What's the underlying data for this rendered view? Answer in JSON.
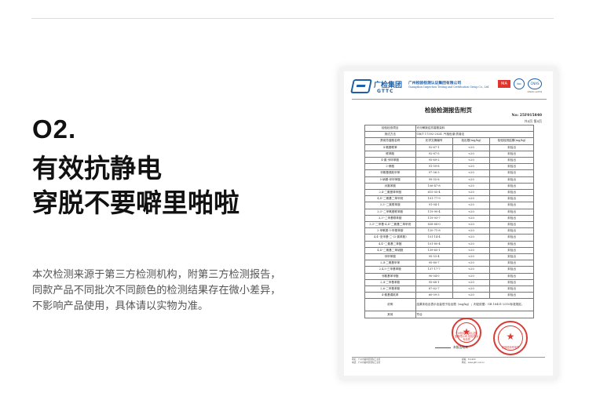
{
  "section": {
    "number": "O2.",
    "headline": [
      "有效抗静电",
      "穿脱不要噼里啪啦"
    ],
    "description": [
      "本次检测来源于第三方检测机构，附第三方检测报告，",
      "同款产品不同批次不同颜色的检测结果存在微小差异，",
      "不影响产品使用，具体请以实物为准。"
    ]
  },
  "report": {
    "brand_cn": "广检集团",
    "brand_en": "GTTC",
    "company_cn": "广州检验检测认证集团有限公司",
    "company_en": "Guangzhou Inspection Testing and Certification Group Co., Ltd.",
    "cert_labels": [
      "MA",
      "ilac",
      "CNAS"
    ],
    "cert_code": "CNAS L1234",
    "title": "检验检测报告附页",
    "report_no": "No: 25F015840",
    "page": "共4页  第4页",
    "item_label": "检验检测项目",
    "item_value": "可分解致癌芳香胺染料",
    "method_label": "测试方法",
    "method_value": "GB/T 17592-2024 ,气相色谱-质谱法",
    "columns": [
      "禁用芳香胺名称",
      "化学文摘编号",
      "检出限(mg/kg)",
      "检验检测结果(mg/kg)"
    ],
    "rows": [
      [
        "4-氨基联苯",
        "92-67-1",
        "<20",
        "未检出"
      ],
      [
        "联苯胺",
        "92-87-5",
        "<20",
        "未检出"
      ],
      [
        "4-氯-邻甲苯胺",
        "95-69-2",
        "<20",
        "未检出"
      ],
      [
        "2-萘胺",
        "91-59-8",
        "<20",
        "未检出"
      ],
      [
        "邻氨基偶氮甲苯",
        "97-56-3",
        "<20",
        "未检出"
      ],
      [
        "5-硝基-邻甲苯胺",
        "99-55-8",
        "<20",
        "未检出"
      ],
      [
        "对氯苯胺",
        "106-47-8",
        "<20",
        "未检出"
      ],
      [
        "2,4-二氨基苯甲醚",
        "615-05-4",
        "<20",
        "未检出"
      ],
      [
        "4,4'-二氨基二苯甲烷",
        "101-77-9",
        "<20",
        "未检出"
      ],
      [
        "3,3'-二氯联苯胺",
        "91-94-1",
        "<20",
        "未检出"
      ],
      [
        "3,3'-二甲氧基联苯胺",
        "119-90-4",
        "<20",
        "未检出"
      ],
      [
        "3,3'-二甲基联苯胺",
        "119-93-7",
        "<20",
        "未检出"
      ],
      [
        "3,3'-二甲基-4,4'-二氨基二苯甲烷",
        "838-88-0",
        "<20",
        "未检出"
      ],
      [
        "2-甲氧基-5-甲基苯胺",
        "120-71-8",
        "<20",
        "未检出"
      ],
      [
        "4,4'-亚甲基-二-(2-氯苯胺)",
        "101-14-4",
        "<20",
        "未检出"
      ],
      [
        "4,4'-二氨基二苯醚",
        "101-80-4",
        "<20",
        "未检出"
      ],
      [
        "4,4'-二氨基二苯硫醚",
        "139-65-1",
        "<20",
        "未检出"
      ],
      [
        "邻甲苯胺",
        "95-53-4",
        "<20",
        "未检出"
      ],
      [
        "2,4-二氨基甲苯",
        "95-80-7",
        "<20",
        "未检出"
      ],
      [
        "2,4,5-三甲基苯胺",
        "137-17-7",
        "<20",
        "未检出"
      ],
      [
        "邻氨基苯甲醚",
        "90-04-0",
        "<20",
        "未检出"
      ],
      [
        "2,4-二甲基苯胺",
        "95-68-1",
        "<20",
        "未检出"
      ],
      [
        "2,6-二甲基苯胺",
        "87-62-7",
        "<20",
        "未检出"
      ],
      [
        "4-氨基偶氮苯",
        "60-09-3",
        "<20",
        "未检出"
      ]
    ],
    "note_label": "说明",
    "note_text": "结果未检出表示含量低于检出限（mg/kg）；判定依据：GB 18401-2010标准规定。",
    "other_label": "其他",
    "other_value": "符合",
    "stamp_1_text": "广州检验检测认证集团有限公司 检验检测专用章",
    "stamp_2_text": "检验检测专用章",
    "end_text": "本报告结束",
    "footer_left": [
      "地址：广州市番禺区国际工业区",
      "电话：广州市番禺区国际工业区"
    ],
    "footer_right": [
      "邮编：511400",
      "网址：www.gttc.net.cn"
    ]
  }
}
